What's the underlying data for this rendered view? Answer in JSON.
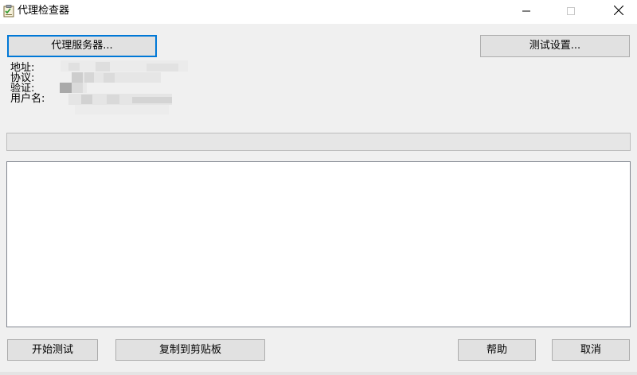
{
  "window": {
    "title": "代理检查器",
    "icon": "app-checklist-icon"
  },
  "top_buttons": {
    "proxy_server": "代理服务器...",
    "test_settings": "测试设置..."
  },
  "info": {
    "address_label": "地址:",
    "protocol_label": "协议:",
    "auth_label": "验证:",
    "username_label": "用户名:"
  },
  "progress": {
    "value": 0
  },
  "log": {
    "content": ""
  },
  "bottom_buttons": {
    "start_test": "开始测试",
    "copy_clipboard": "复制到剪贴板",
    "help": "帮助",
    "cancel": "取消"
  },
  "colors": {
    "accent": "#0078d7",
    "window_bg": "#f0f0f0",
    "button_bg": "#e1e1e1"
  }
}
